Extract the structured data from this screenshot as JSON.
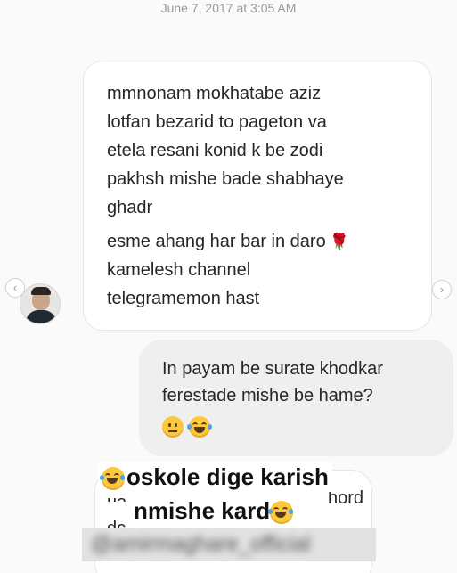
{
  "thread": {
    "timestamp": "June 7, 2017 at 3:05 AM"
  },
  "incoming_message": {
    "paragraphs": [
      "mmnonam mokhatabe aziz lotfan bezarid to pageton va etela resani konid k be zodi pakhsh mishe bade shabhaye ghadr",
      "esme ahang har bar in daro",
      "kamelesh channel telegramemon hast"
    ],
    "lines": [
      "mmnonam mokhatabe aziz",
      "lotfan bezarid to pageton va",
      "etela resani konid k be zodi",
      "pakhsh mishe bade shabhaye",
      "ghadr",
      "esme ahang har bar in daro",
      "kamelesh channel",
      "telegramemon hast"
    ],
    "trailing_emoji": "rose-icon"
  },
  "outgoing_message": {
    "lines": [
      "In payam be surate khodkar",
      "ferestade mishe be hame?"
    ],
    "emojis": [
      "neutral-face-icon",
      "tears-of-joy-icon"
    ]
  },
  "partial_message": {
    "fragments": [
      "ua",
      "dc",
      "hord"
    ]
  },
  "overlay_caption": {
    "line1": "oskole dige karish",
    "line2": "nmishe kard",
    "emoji": "tears-of-joy-icon"
  },
  "watermark": {
    "handle": "@amirmaghare_official"
  },
  "colors": {
    "incoming_bubble": "#ffffff",
    "outgoing_bubble": "#efefef",
    "timestamp_text": "#9a9a9a"
  }
}
